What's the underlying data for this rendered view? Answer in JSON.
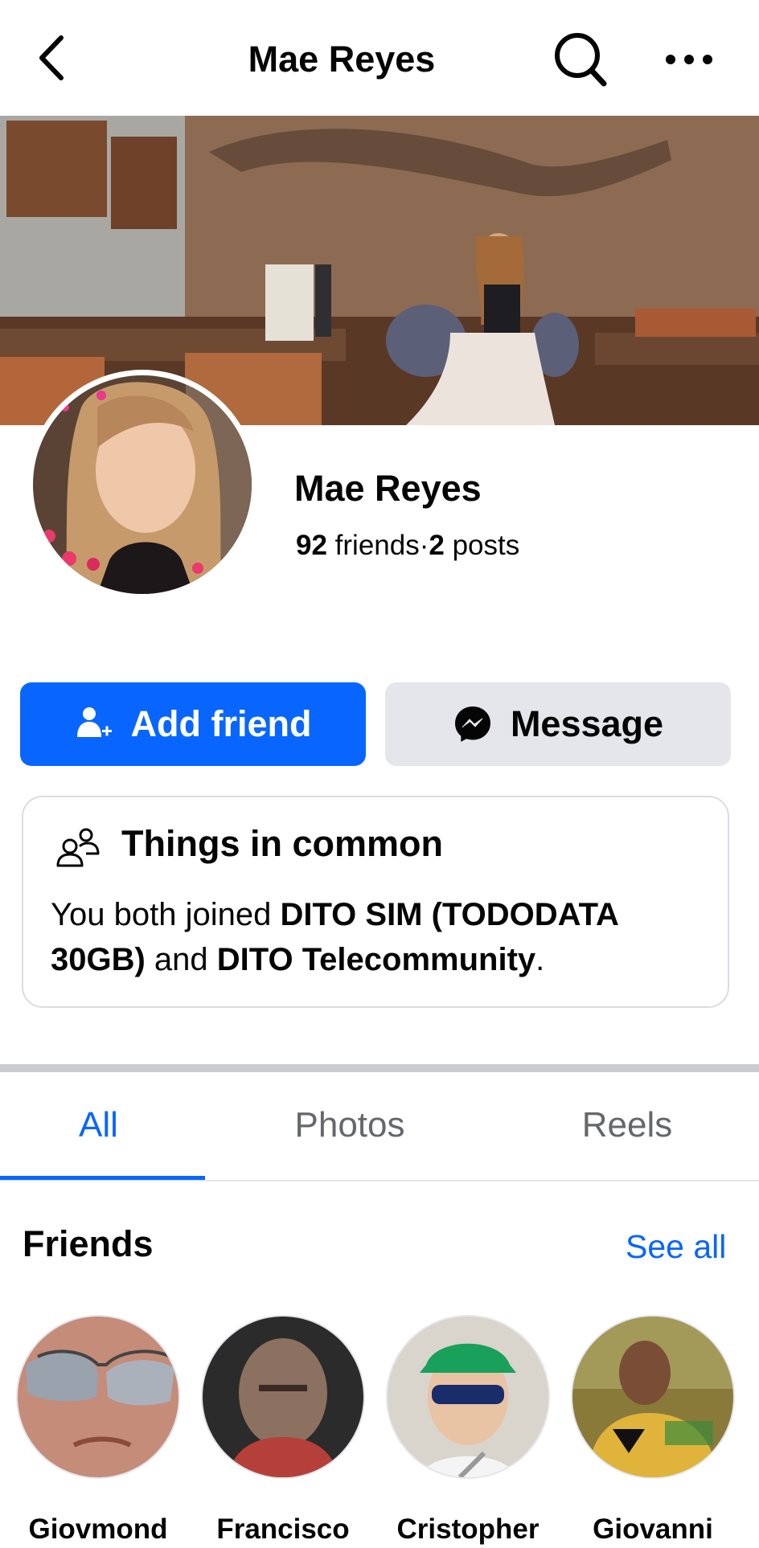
{
  "header": {
    "title": "Mae Reyes",
    "back_icon": "chevron-left-icon",
    "search_icon": "search-icon",
    "more_icon": "more-horizontal-icon"
  },
  "profile": {
    "name": "Mae Reyes",
    "friends_count": "92",
    "friends_label": "friends",
    "separator": "·",
    "posts_count": "2",
    "posts_label": "posts"
  },
  "actions": {
    "add_friend_label": "Add friend",
    "message_label": "Message"
  },
  "common": {
    "title": "Things in common",
    "text_prefix": "You both joined ",
    "group1": "DITO SIM (TODODATA 30GB)",
    "text_mid": " and ",
    "group2": "DITO Telecommunity",
    "text_suffix": "."
  },
  "tabs": [
    {
      "label": "All",
      "active": true
    },
    {
      "label": "Photos",
      "active": false
    },
    {
      "label": "Reels",
      "active": false
    }
  ],
  "friends": {
    "title": "Friends",
    "see_all": "See all",
    "items": [
      {
        "name": "Giovmond"
      },
      {
        "name": "Francisco"
      },
      {
        "name": "Cristopher"
      },
      {
        "name": "Giovanni"
      }
    ]
  },
  "colors": {
    "accent": "#0866ff",
    "secondary_button": "#e4e6eb",
    "muted_text": "#65676b"
  }
}
